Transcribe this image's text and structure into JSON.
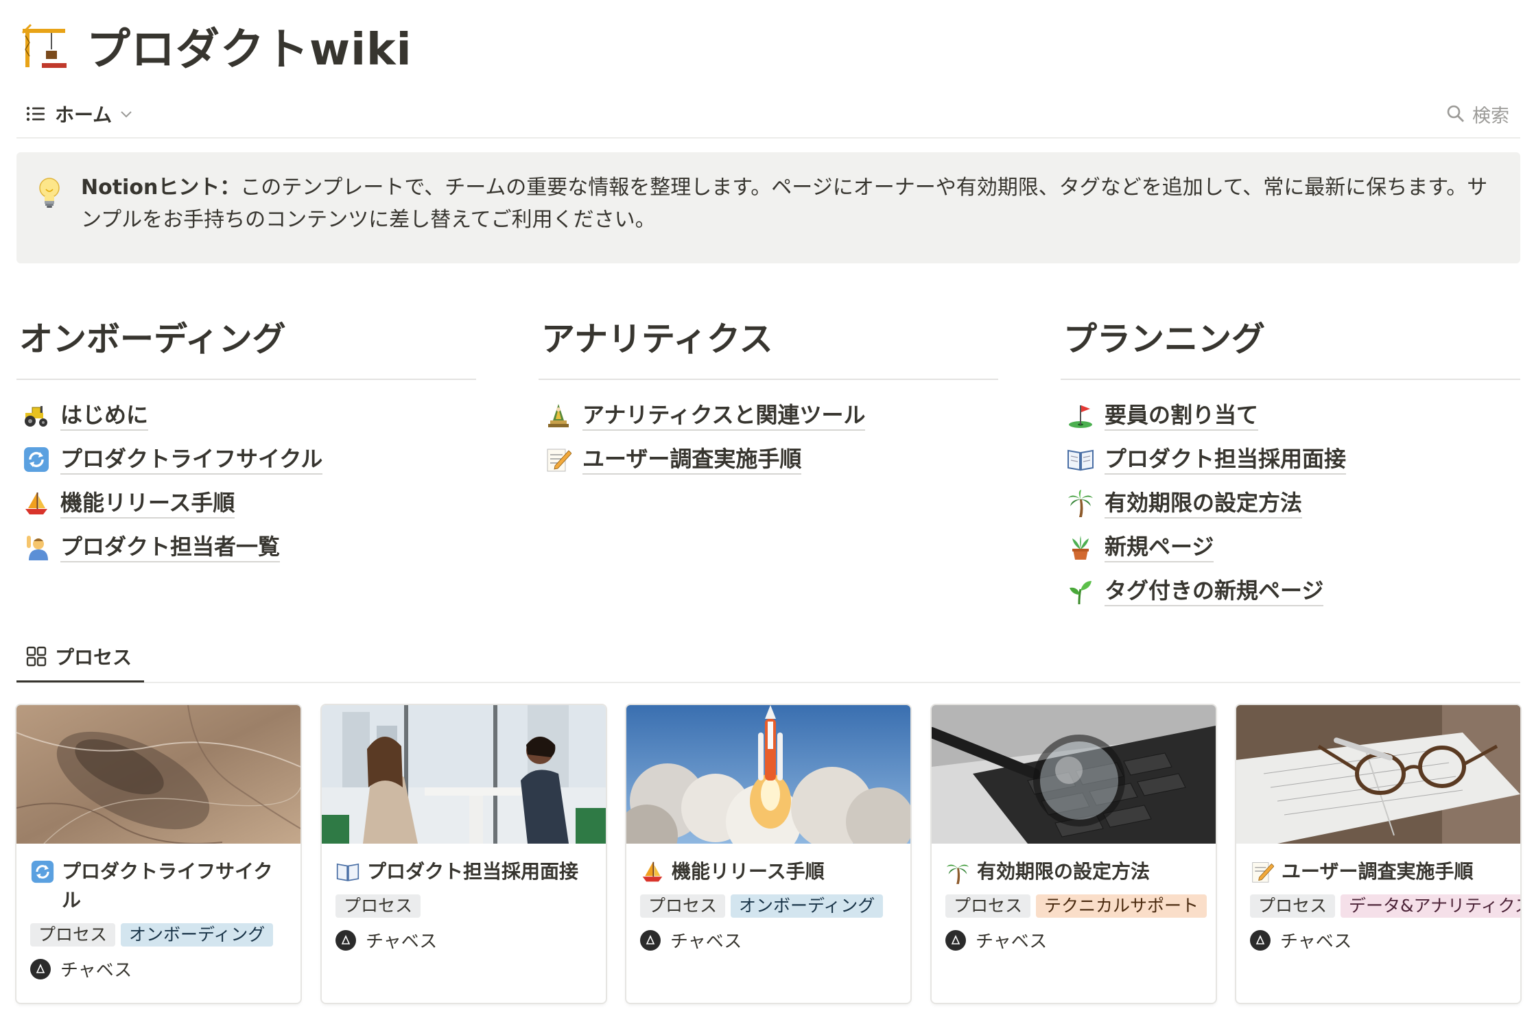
{
  "page": {
    "title": "プロダクトwiki",
    "icon": "building-construction-icon"
  },
  "view": {
    "active": "ホーム",
    "search_label": "検索"
  },
  "callout": {
    "icon": "light-bulb-icon",
    "bold": "Notionヒント：",
    "text": "このテンプレートで、チームの重要な情報を整理します。ページにオーナーや有効期限、タグなどを追加して、常に最新に保ちます。サンプルをお手持ちのコンテンツに差し替えてご利用ください。"
  },
  "columns": [
    {
      "heading": "オンボーディング",
      "items": [
        {
          "label": "はじめに",
          "icon": "tractor-icon"
        },
        {
          "label": "プロダクトライフサイクル",
          "icon": "cycle-arrows-icon"
        },
        {
          "label": "機能リリース手順",
          "icon": "sailboat-icon"
        },
        {
          "label": "プロダクト担当者一覧",
          "icon": "person-raising-hand-icon"
        }
      ]
    },
    {
      "heading": "アナリティクス",
      "items": [
        {
          "label": "アナリティクスと関連ツール",
          "icon": "japanese-dolls-icon"
        },
        {
          "label": "ユーザー調査実施手順",
          "icon": "memo-icon"
        }
      ]
    },
    {
      "heading": "プランニング",
      "items": [
        {
          "label": "要員の割り当て",
          "icon": "golf-flag-icon"
        },
        {
          "label": "プロダクト担当採用面接",
          "icon": "open-book-icon"
        },
        {
          "label": "有効期限の設定方法",
          "icon": "palm-tree-icon"
        },
        {
          "label": "新規ページ",
          "icon": "potted-plant-icon"
        },
        {
          "label": "タグ付きの新規ページ",
          "icon": "seedling-icon"
        }
      ]
    }
  ],
  "gallery": {
    "tab": "プロセス",
    "cards": [
      {
        "title": "プロダクトライフサイクル",
        "icon": "cycle-arrows-icon",
        "cover": "desert-aerial-cover",
        "tags": [
          "プロセス",
          "オンボーディング"
        ],
        "person": "チャベス"
      },
      {
        "title": "プロダクト担当採用面接",
        "icon": "open-book-icon",
        "cover": "interview-cover",
        "tags": [
          "プロセス"
        ],
        "person": "チャベス"
      },
      {
        "title": "機能リリース手順",
        "icon": "sailboat-icon",
        "cover": "rocket-launch-cover",
        "tags": [
          "プロセス",
          "オンボーディング"
        ],
        "person": "チャベス"
      },
      {
        "title": "有効期限の設定方法",
        "icon": "palm-tree-icon",
        "cover": "magnifier-keyboard-cover",
        "tags": [
          "プロセス",
          "テクニカルサポート"
        ],
        "person": "チャベス"
      },
      {
        "title": "ユーザー調査実施手順",
        "icon": "memo-icon",
        "cover": "glasses-notebook-cover",
        "tags": [
          "プロセス",
          "データ&アナリティクス"
        ],
        "person": "チャベス"
      }
    ]
  },
  "colors": {
    "text": "#37352f",
    "callout_bg": "#f1f1ef",
    "tag_gray": "#ebeced",
    "tag_blue": "#d3e5ef",
    "tag_orange": "#fadec9",
    "tag_pink": "#f5e0e9"
  }
}
